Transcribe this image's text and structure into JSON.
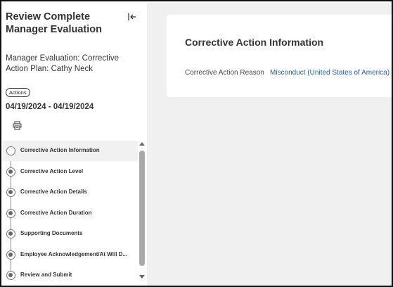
{
  "task": {
    "title": "Review Complete Manager Evaluation",
    "subtitle": "Manager Evaluation: Corrective Action Plan: Cathy Neck",
    "actions_label": "Actions",
    "date_range": "04/19/2024 - 04/19/2024"
  },
  "steps": [
    {
      "label": "Corrective Action Information",
      "state": "current"
    },
    {
      "label": "Corrective Action Level",
      "state": "pending"
    },
    {
      "label": "Corrective Action Details",
      "state": "pending"
    },
    {
      "label": "Corrective Action Duration",
      "state": "pending"
    },
    {
      "label": "Supporting Documents",
      "state": "pending"
    },
    {
      "label": "Employee Acknowledgement/At Will D...",
      "state": "pending"
    },
    {
      "label": "Review and Submit",
      "state": "pending"
    }
  ],
  "section": {
    "title": "Corrective Action Information",
    "fields": [
      {
        "label": "Corrective Action Reason",
        "value": "Misconduct (United States of America)"
      }
    ]
  },
  "icons": {
    "collapse": "collapse-left-icon",
    "print": "print-icon"
  },
  "colors": {
    "link": "#1f5fa8",
    "background": "#f0f0f0"
  }
}
